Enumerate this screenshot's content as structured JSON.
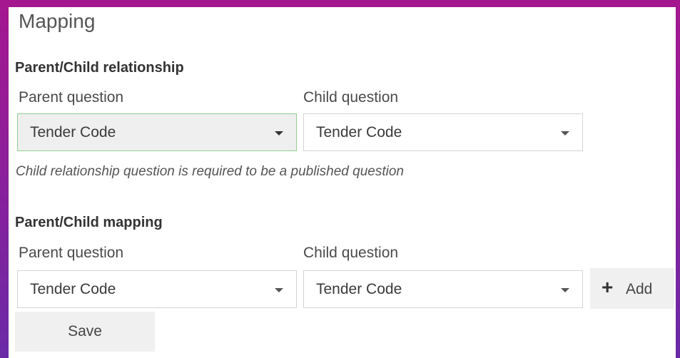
{
  "title": "Mapping",
  "relationship": {
    "heading": "Parent/Child relationship",
    "parent_label": "Parent question",
    "child_label": "Child question",
    "parent_value": "Tender Code",
    "child_value": "Tender Code",
    "hint": "Child relationship question is required to be a published question"
  },
  "mapping": {
    "heading": "Parent/Child mapping",
    "parent_label": "Parent question",
    "child_label": "Child question",
    "parent_value": "Tender Code",
    "child_value": "Tender Code",
    "add_label": "Add",
    "add_icon": "+"
  },
  "save_label": "Save",
  "icons": {
    "dropdown": "chevron-down-icon",
    "add": "plus-icon"
  },
  "colors": {
    "background_gradient_top": "#a5178f",
    "background_gradient_bottom": "#6a2aa6",
    "focused_border": "#8fcf8f",
    "button_bg": "#f0f0f0"
  }
}
